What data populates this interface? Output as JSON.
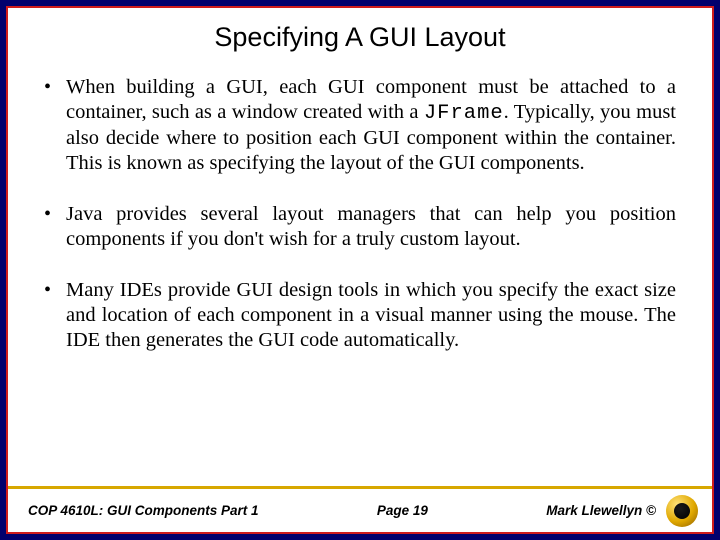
{
  "title": "Specifying A GUI Layout",
  "bullets": {
    "b1_pre": "When building a GUI, each GUI component must be attached to a container, such as a window created with a ",
    "b1_code": "JFrame",
    "b1_post": ".  Typically, you must also decide where to position each GUI component within the container.  This is known as specifying the layout of the GUI components.",
    "b2": "Java provides several layout managers that can help you position components if you don't wish for a truly custom layout.",
    "b3": "Many IDEs provide GUI design tools in which you specify the exact size and location of each component in a visual manner using the mouse.  The IDE then generates the GUI code automatically."
  },
  "footer": {
    "course": "COP 4610L: GUI Components Part 1",
    "page_label": "Page 19",
    "author": "Mark Llewellyn ©"
  }
}
